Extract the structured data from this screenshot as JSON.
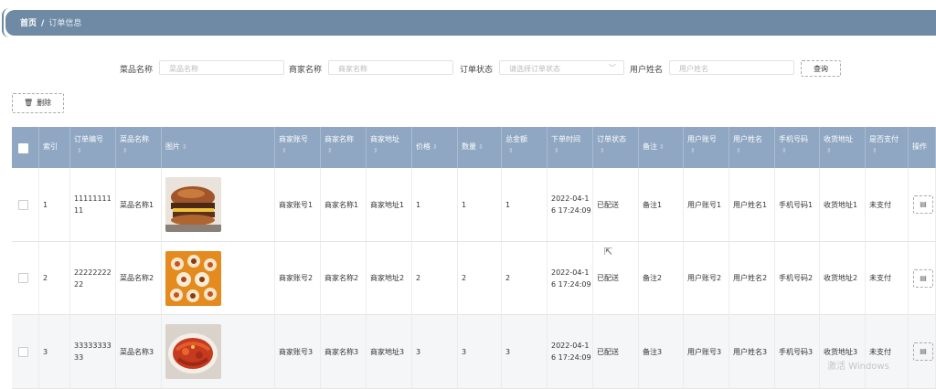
{
  "breadcrumb": {
    "home": "首页",
    "separator": "/",
    "current": "订单信息"
  },
  "search": {
    "dish_name_label": "菜品名称",
    "dish_name_placeholder": "菜品名称",
    "merchant_name_label": "商家名称",
    "merchant_name_placeholder": "商家名称",
    "order_status_label": "订单状态",
    "order_status_placeholder": "请选择订单状态",
    "user_name_label": "用户姓名",
    "user_name_placeholder": "用户姓名",
    "query_button": "查询"
  },
  "toolbar": {
    "delete_button": "删除",
    "delete_icon": "trash-icon"
  },
  "table": {
    "columns": [
      "索引",
      "订单编号",
      "菜品名称",
      "图片",
      "商家账号",
      "商家名称",
      "商家地址",
      "价格",
      "数量",
      "总金额",
      "下单时间",
      "订单状态",
      "备注",
      "用户账号",
      "用户姓名",
      "手机号码",
      "收货地址",
      "是否支付",
      "操作"
    ],
    "rows": [
      {
        "index": "1",
        "order_no": "1111111111",
        "dish": "菜品名称1",
        "image": "burger-image",
        "merchant_account": "商家账号1",
        "merchant_name": "商家名称1",
        "merchant_addr": "商家地址1",
        "price": "1",
        "qty": "1",
        "total": "1",
        "time": "2022-04-16 17:24:09",
        "status": "已配送",
        "remark": "备注1",
        "user_account": "用户账号1",
        "user_name": "用户姓名1",
        "phone": "手机号码1",
        "address": "收货地址1",
        "paid": "未支付"
      },
      {
        "index": "2",
        "order_no": "2222222222",
        "dish": "菜品名称2",
        "image": "dumplings-image",
        "merchant_account": "商家账号2",
        "merchant_name": "商家名称2",
        "merchant_addr": "商家地址2",
        "price": "2",
        "qty": "2",
        "total": "2",
        "time": "2022-04-16 17:24:09",
        "status": "已配送",
        "remark": "备注2",
        "user_account": "用户账号2",
        "user_name": "用户姓名2",
        "phone": "手机号码2",
        "address": "收货地址2",
        "paid": "未支付"
      },
      {
        "index": "3",
        "order_no": "3333333333",
        "dish": "菜品名称3",
        "image": "crawfish-image",
        "merchant_account": "商家账号3",
        "merchant_name": "商家名称3",
        "merchant_addr": "商家地址3",
        "price": "3",
        "qty": "3",
        "total": "3",
        "time": "2022-04-16 17:24:09",
        "status": "已配送",
        "remark": "备注3",
        "user_account": "用户账号3",
        "user_name": "用户姓名3",
        "phone": "手机号码3",
        "address": "收货地址3",
        "paid": "未支付"
      }
    ]
  },
  "watermark": "激活 Windows"
}
